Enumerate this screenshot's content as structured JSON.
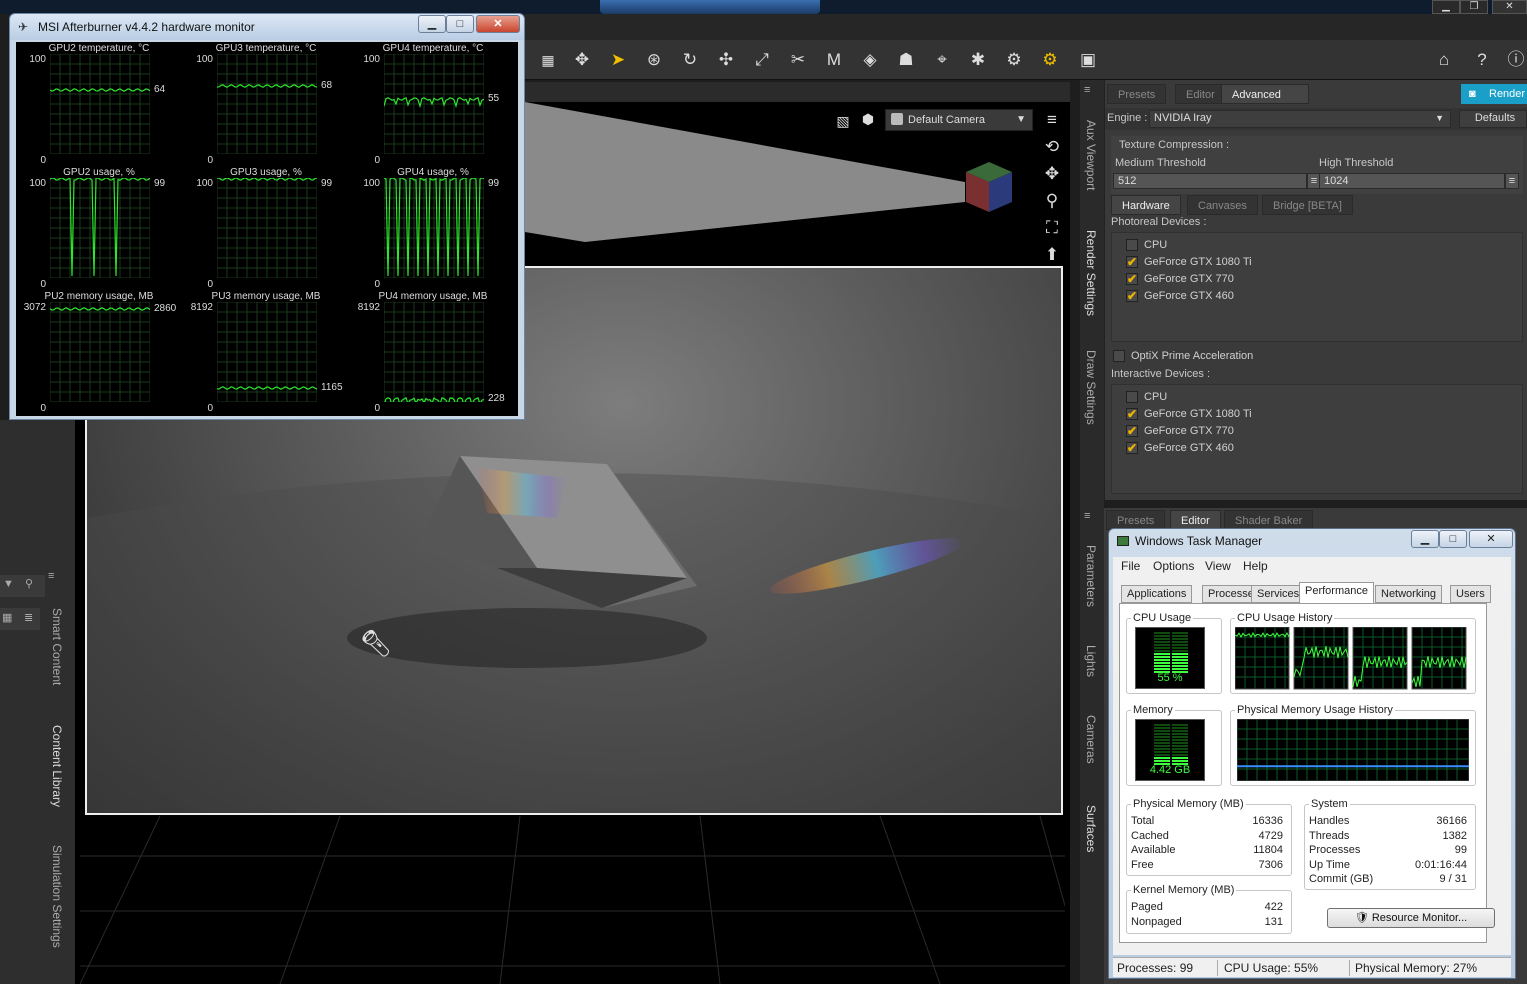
{
  "msi": {
    "title": "MSI Afterburner v4.4.2 hardware monitor",
    "graphs": [
      {
        "title": "GPU2 temperature, °C",
        "max": "100",
        "min": "0",
        "current": "64",
        "level": 0.64
      },
      {
        "title": "GPU3 temperature, °C",
        "max": "100",
        "min": "0",
        "current": "68",
        "level": 0.68
      },
      {
        "title": "GPU4 temperature, °C",
        "max": "100",
        "min": "0",
        "current": "55",
        "level": 0.55
      },
      {
        "title": "GPU2 usage, %",
        "max": "100",
        "min": "0",
        "current": "99",
        "level": 0.99
      },
      {
        "title": "GPU3 usage, %",
        "max": "100",
        "min": "0",
        "current": "99",
        "level": 0.99
      },
      {
        "title": "GPU4 usage, %",
        "max": "100",
        "min": "0",
        "current": "99",
        "level": 0.99
      },
      {
        "title": "PU2 memory usage, MB",
        "max": "3072",
        "min": "0",
        "current": "2860",
        "level": 0.93
      },
      {
        "title": "PU3 memory usage, MB",
        "max": "8192",
        "min": "0",
        "current": "1165",
        "level": 0.14
      },
      {
        "title": "PU4 memory usage, MB",
        "max": "8192",
        "min": "0",
        "current": "228",
        "level": 0.03
      }
    ]
  },
  "viewport": {
    "camera": "Default Camera"
  },
  "render_panel": {
    "tabs": [
      "Presets",
      "Editor",
      "Advanced"
    ],
    "render_label": "Render",
    "engine_label": "Engine :",
    "engine_value": "NVIDIA Iray",
    "defaults_label": "Defaults",
    "texture_compression": "Texture Compression :",
    "medium_threshold_label": "Medium Threshold",
    "medium_threshold_value": "512",
    "high_threshold_label": "High Threshold",
    "high_threshold_value": "1024",
    "sub_tabs": [
      "Hardware",
      "Canvases",
      "Bridge [BETA]"
    ],
    "photoreal_label": "Photoreal Devices :",
    "photoreal_devices": [
      {
        "name": "CPU",
        "checked": false
      },
      {
        "name": "GeForce GTX 1080 Ti",
        "checked": true
      },
      {
        "name": "GeForce GTX 770",
        "checked": true
      },
      {
        "name": "GeForce GTX 460",
        "checked": true
      }
    ],
    "optix_label": "OptiX Prime Acceleration",
    "interactive_label": "Interactive Devices :",
    "interactive_devices": [
      {
        "name": "CPU",
        "checked": false
      },
      {
        "name": "GeForce GTX 1080 Ti",
        "checked": true
      },
      {
        "name": "GeForce GTX 770",
        "checked": true
      },
      {
        "name": "GeForce GTX 460",
        "checked": true
      }
    ]
  },
  "right_tabs_upper": [
    "Aux Viewport",
    "Render Settings",
    "Draw Settings"
  ],
  "right_tabs_lower": [
    "Parameters",
    "Lights",
    "Cameras",
    "Surfaces"
  ],
  "left_tabs": [
    "Smart Content",
    "Content Library",
    "Simulation Settings"
  ],
  "surface_panel_tabs": [
    "Presets",
    "Editor",
    "Shader Baker"
  ],
  "task_manager": {
    "title": "Windows Task Manager",
    "menu": [
      "File",
      "Options",
      "View",
      "Help"
    ],
    "tabs": [
      "Applications",
      "Processes",
      "Services",
      "Performance",
      "Networking",
      "Users"
    ],
    "cpu_usage_label": "CPU Usage",
    "cpu_usage_value": "55 %",
    "cpu_usage_level": 0.55,
    "cpu_history_label": "CPU Usage History",
    "memory_label": "Memory",
    "memory_value": "4.42 GB",
    "memory_level": 0.27,
    "memory_history_label": "Physical Memory Usage History",
    "physical_memory": {
      "label": "Physical Memory (MB)",
      "rows": [
        {
          "k": "Total",
          "v": "16336"
        },
        {
          "k": "Cached",
          "v": "4729"
        },
        {
          "k": "Available",
          "v": "11804"
        },
        {
          "k": "Free",
          "v": "7306"
        }
      ]
    },
    "kernel_memory": {
      "label": "Kernel Memory (MB)",
      "rows": [
        {
          "k": "Paged",
          "v": "422"
        },
        {
          "k": "Nonpaged",
          "v": "131"
        }
      ]
    },
    "system": {
      "label": "System",
      "rows": [
        {
          "k": "Handles",
          "v": "36166"
        },
        {
          "k": "Threads",
          "v": "1382"
        },
        {
          "k": "Processes",
          "v": "99"
        },
        {
          "k": "Up Time",
          "v": "0:01:16:44"
        },
        {
          "k": "Commit (GB)",
          "v": "9 / 31"
        }
      ]
    },
    "resource_monitor_label": "Resource Monitor...",
    "status": {
      "processes": "Processes: 99",
      "cpu": "CPU Usage: 55%",
      "memory": "Physical Memory: 27%"
    }
  },
  "colors": {
    "graph_green": "#2ee62e",
    "check_orange": "#f0b400",
    "render_button": "#1aa0c8"
  }
}
